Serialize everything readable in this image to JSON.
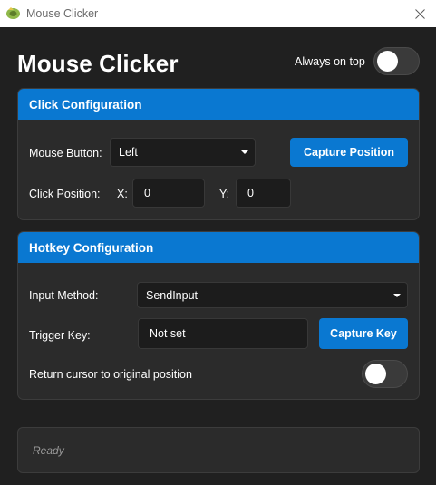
{
  "window": {
    "title": "Mouse Clicker"
  },
  "header": {
    "title": "Mouse Clicker",
    "always_on_top_label": "Always on top",
    "always_on_top_enabled": false
  },
  "click_config": {
    "title": "Click Configuration",
    "mouse_button_label": "Mouse Button:",
    "mouse_button_value": "Left",
    "capture_position_label": "Capture Position",
    "click_position_label": "Click Position:",
    "x_label": "X:",
    "x_value": "0",
    "y_label": "Y:",
    "y_value": "0"
  },
  "hotkey_config": {
    "title": "Hotkey Configuration",
    "input_method_label": "Input Method:",
    "input_method_value": "SendInput",
    "trigger_key_label": "Trigger Key:",
    "trigger_key_value": "Not set",
    "capture_key_label": "Capture Key",
    "return_cursor_label": "Return cursor to original position",
    "return_cursor_enabled": false
  },
  "status": {
    "text": "Ready"
  },
  "colors": {
    "accent": "#0a78d1",
    "background": "#202020",
    "card": "#2b2b2b"
  },
  "icons": {
    "app": "mouse-app-icon",
    "close": "close-icon",
    "dropdown": "chevron-down-icon"
  }
}
